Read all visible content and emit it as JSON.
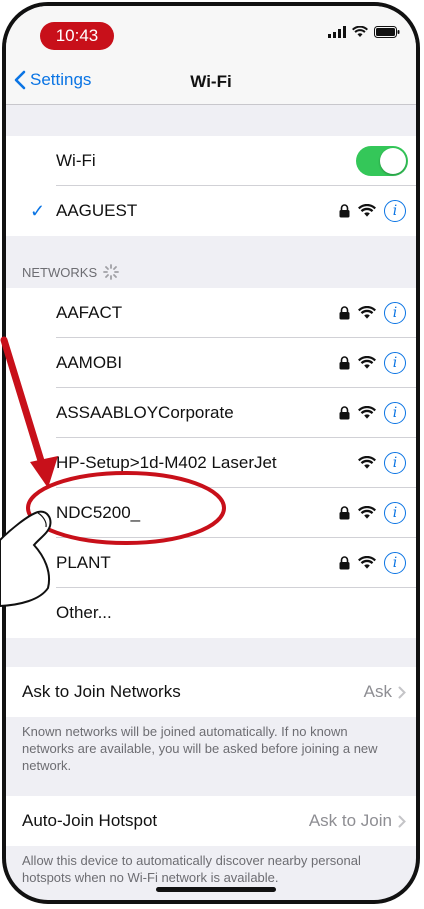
{
  "status": {
    "time": "10:43"
  },
  "nav": {
    "back_label": "Settings",
    "title": "Wi-Fi"
  },
  "wifi": {
    "toggle_label": "Wi-Fi",
    "toggle_on": true,
    "connected": "AAGUEST"
  },
  "networks_header": "NETWORKS",
  "networks": [
    {
      "name": "AAFACT",
      "locked": true
    },
    {
      "name": "AAMOBI",
      "locked": true
    },
    {
      "name": "ASSAABLOYCorporate",
      "locked": true
    },
    {
      "name": "HP-Setup>1d-M402 LaserJet",
      "locked": false
    },
    {
      "name": "NDC5200_",
      "locked": true
    },
    {
      "name": "PLANT",
      "locked": true
    },
    {
      "name": "Other..."
    }
  ],
  "ask_join": {
    "label": "Ask to Join Networks",
    "value": "Ask",
    "footnote": "Known networks will be joined automatically. If no known networks are available, you will be asked before joining a new network."
  },
  "hotspot": {
    "label": "Auto-Join Hotspot",
    "value": "Ask to Join",
    "footnote": "Allow this device to automatically discover nearby personal hotspots when no Wi-Fi network is available."
  },
  "colors": {
    "accent": "#0a74e4",
    "toggle": "#34c759",
    "highlight": "#c8101a"
  }
}
